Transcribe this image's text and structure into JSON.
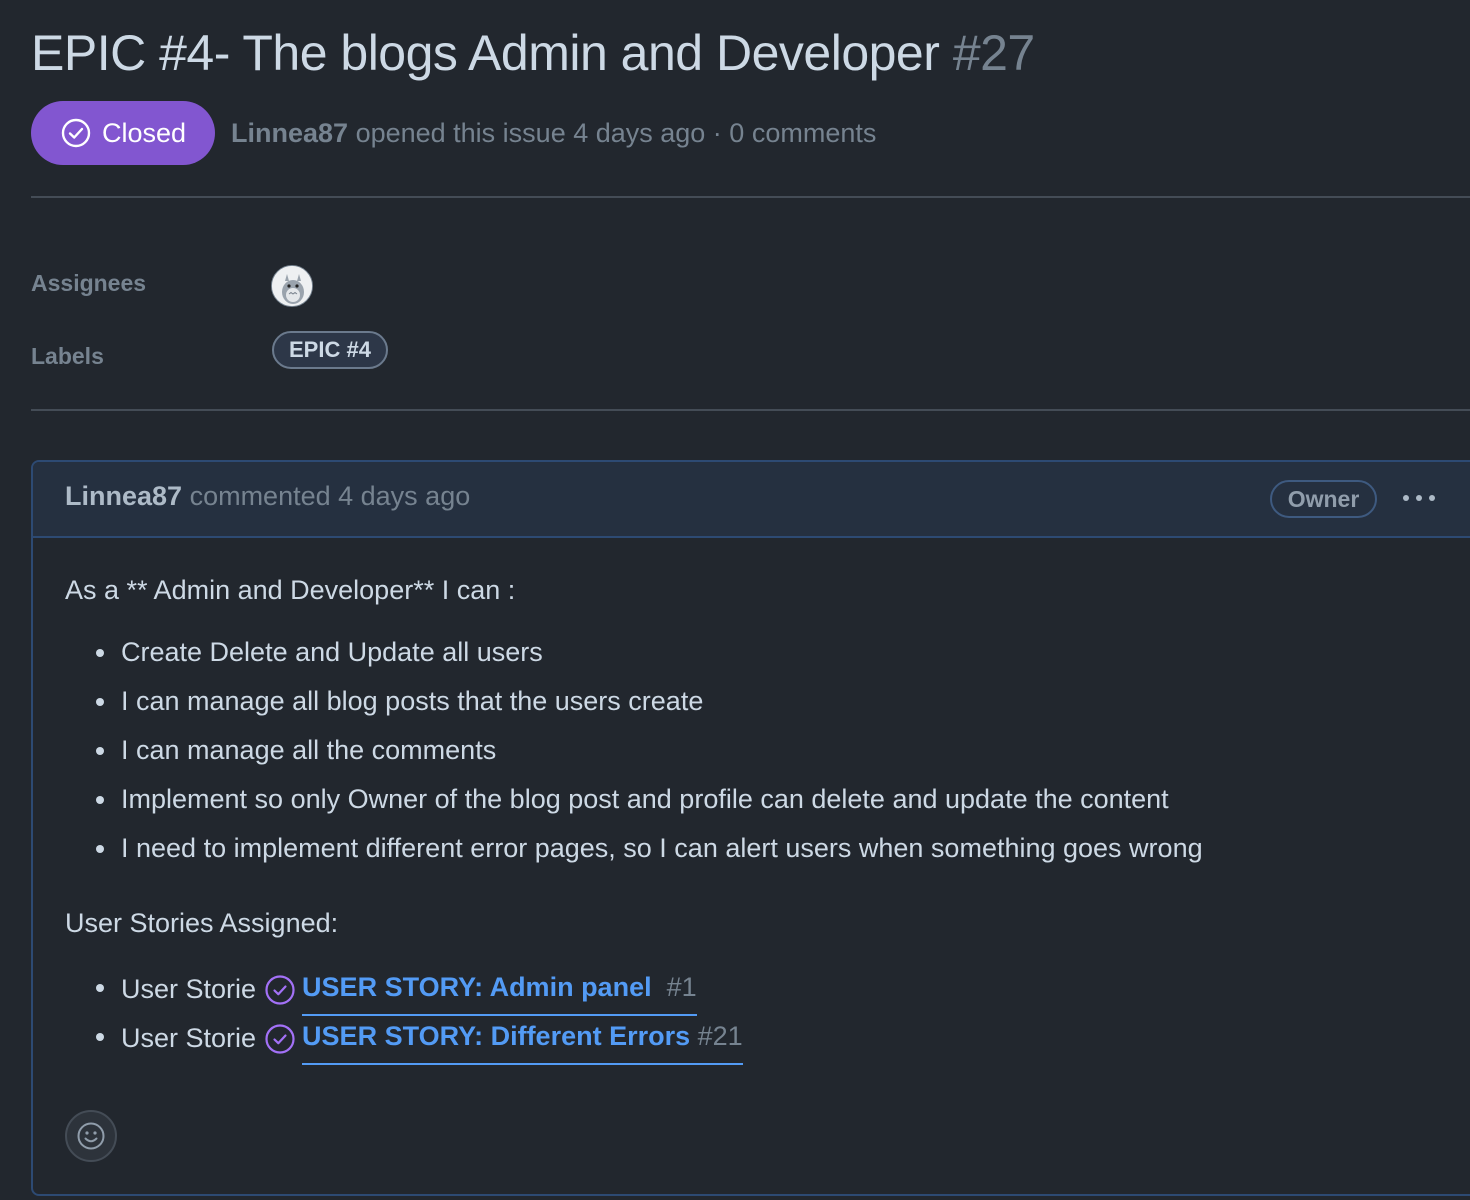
{
  "issue": {
    "title": "EPIC #4- The blogs Admin and Developer",
    "number": "#27",
    "state": "Closed",
    "author": "Linnea87",
    "meta_text": "opened this issue 4 days ago · 0 comments"
  },
  "sidebar": {
    "assignees_label": "Assignees",
    "labels_label": "Labels",
    "label_name": "EPIC #4"
  },
  "comment": {
    "author": "Linnea87",
    "action": "commented 4 days ago",
    "role_badge": "Owner",
    "intro": "As a ** Admin and Developer** I can :",
    "items": [
      "Create Delete and Update all users",
      "I can manage all blog posts that the users create",
      "I can manage all the comments",
      "Implement so only Owner of the blog post and profile can delete and update the content",
      "I need to implement different error pages, so I can alert users when something goes wrong"
    ],
    "stories_heading": "User Stories Assigned:",
    "stories": [
      {
        "prefix": "User Storie",
        "title": "USER STORY: Admin panel ",
        "number": "#1"
      },
      {
        "prefix": "User Storie",
        "title": "USER STORY: Different Errors",
        "number": "#21"
      }
    ]
  },
  "colors": {
    "background": "#22272e",
    "closed_purple": "#8256d0",
    "link_blue": "#539bf5",
    "muted": "#768390"
  },
  "icons": {
    "state": "check-circle-icon",
    "more": "kebab-horizontal-icon",
    "reaction": "smiley-icon"
  }
}
